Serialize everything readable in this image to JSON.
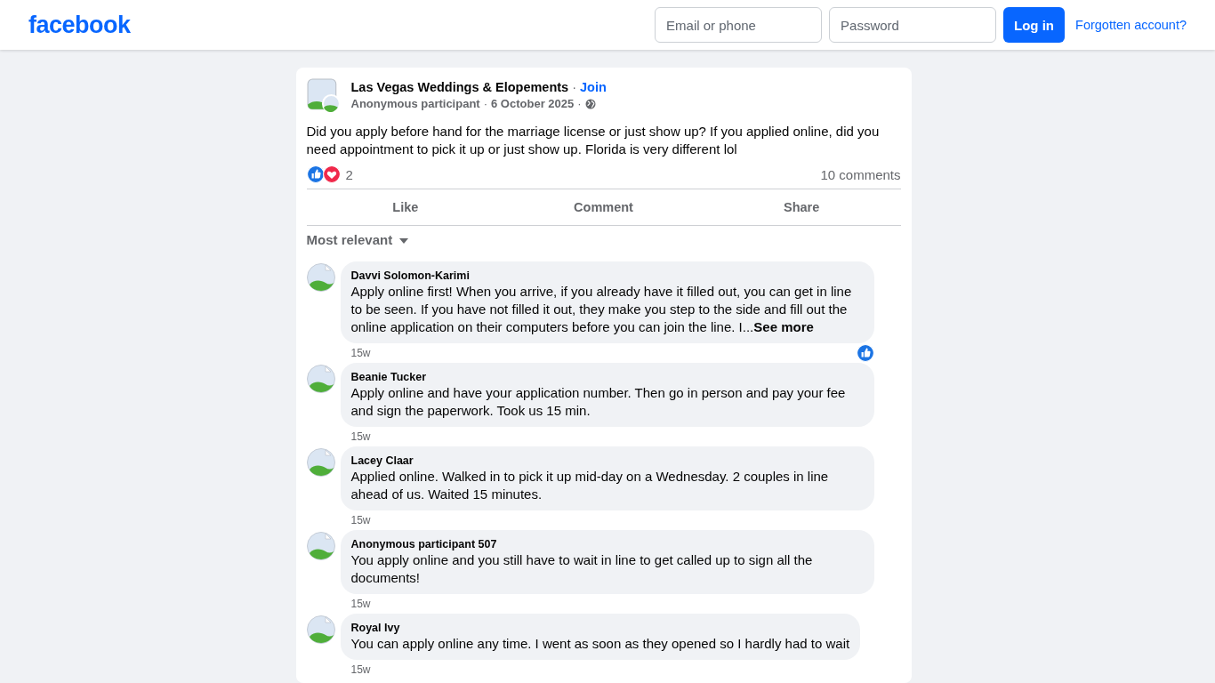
{
  "header": {
    "logo": "facebook",
    "email_placeholder": "Email or phone",
    "password_placeholder": "Password",
    "login": "Log in",
    "forgot": "Forgotten account?"
  },
  "post": {
    "group": "Las Vegas Weddings & Elopements",
    "group_separator": "·",
    "join": "Join",
    "author": "Anonymous participant",
    "author_separator": "·",
    "date": "6 October 2025",
    "date_separator": "·",
    "text": "Did you apply before hand for the marriage license or just show up? If you applied online, did you need appointment to pick it up or just show up. Florida is very different lol",
    "reactions": [
      {
        "kind": "like"
      },
      {
        "kind": "love"
      }
    ],
    "reaction_count": "2",
    "comments_count": "10 comments",
    "actions": [
      "Like",
      "Comment",
      "Share"
    ],
    "sort": "Most relevant"
  },
  "comments": [
    {
      "name": "Davvi Solomon-Karimi",
      "text": "Apply online first! When you arrive, if you already have it filled out, you can get in line to be seen. If you have not filled it out, they make you step to the side and fill out the online application on their computers before you can join the line. I...",
      "see_more": "See more",
      "time": "15w",
      "reaction": {
        "kind": "like"
      }
    },
    {
      "name": "Beanie Tucker",
      "text": "Apply online and have your application number. Then go in person and pay your fee and sign the paperwork. Took us 15 min.",
      "time": "15w"
    },
    {
      "name": "Lacey Claar",
      "text": "Applied online. Walked in to pick it up mid-day on a Wednesday. 2 couples in line ahead of us. Waited 15 minutes.",
      "time": "15w"
    },
    {
      "name": "Anonymous participant 507",
      "text": "You apply online and you still have to wait in line to get called up to sign all the documents!",
      "time": "15w"
    },
    {
      "name": "Royal Ivy",
      "text": "You can apply online any time. I went as soon as they opened so I hardly had to wait",
      "time": "15w"
    }
  ]
}
